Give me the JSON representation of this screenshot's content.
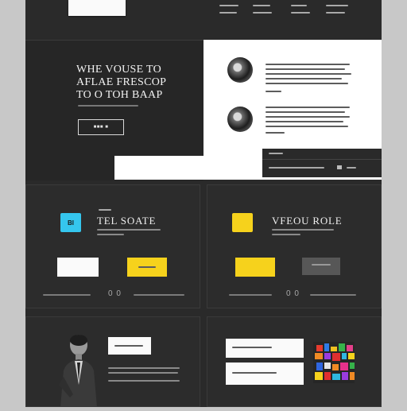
{
  "hero": {
    "title_line1": "WHE VOUSE TO",
    "title_line2": "AFLAE FRESCOP",
    "title_line3": "TO O TOH BAAP",
    "button_label": "■■■ ■"
  },
  "features": [
    {
      "badge": "BI",
      "badge_color": "#35c6ee",
      "title": "TEL SOATE",
      "loop": "0 0"
    },
    {
      "badge": "",
      "badge_color": "#f6d21c",
      "title": "VFEOU ROLE",
      "loop": "0 0"
    }
  ],
  "colors": {
    "accent_yellow": "#f6d21c",
    "accent_cyan": "#35c6ee",
    "dark_bg": "#2a2a2a"
  },
  "icons": {
    "avatar_1": "avatar-icon",
    "avatar_2": "avatar-icon"
  }
}
